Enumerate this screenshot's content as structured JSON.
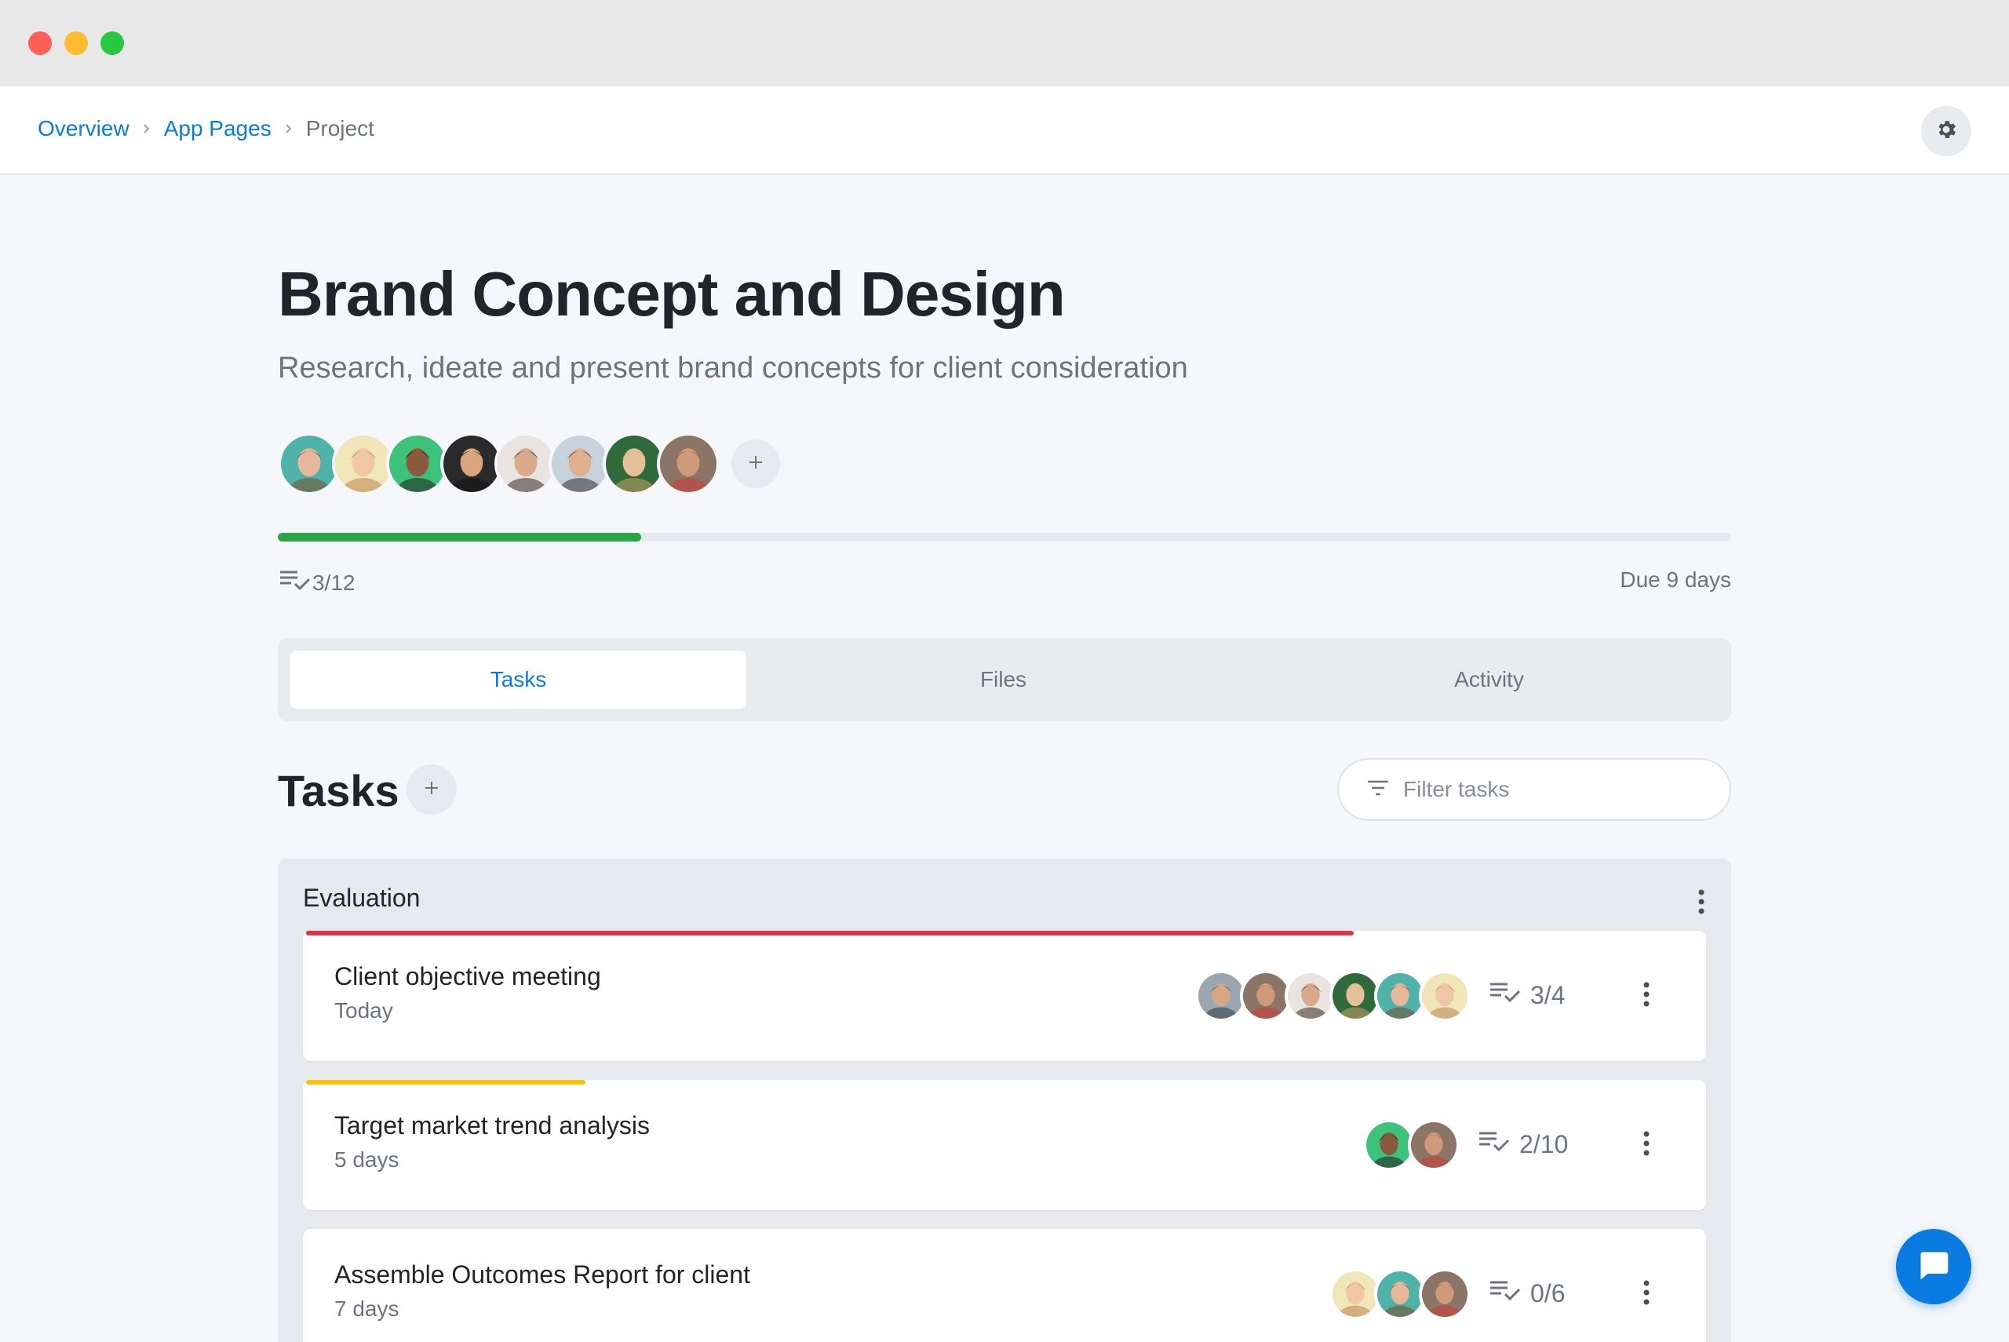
{
  "breadcrumb": [
    {
      "label": "Overview",
      "link": true
    },
    {
      "label": "App Pages",
      "link": true
    },
    {
      "label": "Project",
      "link": false
    }
  ],
  "icons": {
    "settings": "gear-icon",
    "add": "plus-icon",
    "checklist": "checklist-icon",
    "filter": "filter-icon",
    "more": "more-vertical-icon",
    "chat": "chat-icon"
  },
  "colors": {
    "accent": "#0a7be0",
    "progress": "#28a745",
    "urgent": "#dc3545",
    "warning": "#ffc107"
  },
  "project": {
    "title": "Brand Concept and Design",
    "subtitle": "Research, ideate and present brand concepts for client consideration",
    "members": [
      {
        "name": "member-1",
        "bg": "#4fb3a9",
        "skin": "#e6b79a",
        "hair": "#7a4a2a"
      },
      {
        "name": "member-2",
        "bg": "#f0e6b8",
        "skin": "#f0c7a6",
        "hair": "#b98550"
      },
      {
        "name": "member-3",
        "bg": "#3cc27a",
        "skin": "#8a5a3c",
        "hair": "#1f1f1f"
      },
      {
        "name": "member-4",
        "bg": "#2a2a2a",
        "skin": "#d9a67c",
        "hair": "#111111"
      },
      {
        "name": "member-5",
        "bg": "#e9e4e0",
        "skin": "#d8a98a",
        "hair": "#3b2a22"
      },
      {
        "name": "member-6",
        "bg": "#c8d2dc",
        "skin": "#e0b08e",
        "hair": "#2e2e2e"
      },
      {
        "name": "member-7",
        "bg": "#2f6b3a",
        "skin": "#e6c09a",
        "hair": "#c9a063"
      },
      {
        "name": "member-8",
        "bg": "#8a7566",
        "skin": "#cf9a7a",
        "hair": "#d23b34"
      }
    ],
    "progress": 0.25,
    "tasks_done": "3/12",
    "due": "Due 9 days"
  },
  "tabs": [
    {
      "label": "Tasks",
      "active": true
    },
    {
      "label": "Files",
      "active": false
    },
    {
      "label": "Activity",
      "active": false
    }
  ],
  "tasks_section": {
    "title": "Tasks",
    "filter_placeholder": "Filter tasks"
  },
  "group": {
    "title": "Evaluation",
    "tasks": [
      {
        "name": "Client objective meeting",
        "due": "Today",
        "count": "3/4",
        "bar_color": "#dc3545",
        "bar_fraction": 0.75,
        "assignees": [
          {
            "bg": "#9aa7b0",
            "skin": "#d7a784",
            "hair": "#2b3a40"
          },
          {
            "bg": "#8a7566",
            "skin": "#cf9a7a",
            "hair": "#d23b34"
          },
          {
            "bg": "#e9e4e0",
            "skin": "#d8a98a",
            "hair": "#3b2a22"
          },
          {
            "bg": "#2f6b3a",
            "skin": "#e6c09a",
            "hair": "#c9a063"
          },
          {
            "bg": "#4fb3a9",
            "skin": "#e6b79a",
            "hair": "#7a4a2a"
          },
          {
            "bg": "#f0e6b8",
            "skin": "#f0c7a6",
            "hair": "#b98550"
          }
        ]
      },
      {
        "name": "Target market trend analysis",
        "due": "5 days",
        "count": "2/10",
        "bar_color": "#ffc107",
        "bar_fraction": 0.2,
        "assignees": [
          {
            "bg": "#3cc27a",
            "skin": "#8a5a3c",
            "hair": "#1f1f1f"
          },
          {
            "bg": "#8a7566",
            "skin": "#cf9a7a",
            "hair": "#d23b34"
          }
        ]
      },
      {
        "name": "Assemble Outcomes Report for client",
        "due": "7 days",
        "count": "0/6",
        "bar_color": "",
        "bar_fraction": 0,
        "assignees": [
          {
            "bg": "#f0e6b8",
            "skin": "#f0c7a6",
            "hair": "#b98550"
          },
          {
            "bg": "#4fb3a9",
            "skin": "#e6b79a",
            "hair": "#7a4a2a"
          },
          {
            "bg": "#8a7566",
            "skin": "#cf9a7a",
            "hair": "#d23b34"
          }
        ]
      }
    ]
  }
}
